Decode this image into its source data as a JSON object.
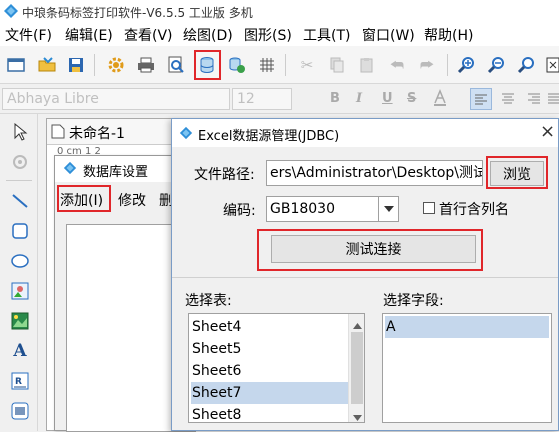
{
  "app": {
    "title": "中琅条码标签打印软件-V6.5.5 工业版 多机"
  },
  "menu": [
    "文件(F)",
    "编辑(E)",
    "查看(V)",
    "绘图(D)",
    "图形(S)",
    "工具(T)",
    "窗口(W)",
    "帮助(H)"
  ],
  "format": {
    "font_name": "Abhaya Libre",
    "font_size": "12",
    "bold": "B",
    "italic": "I",
    "underline": "U",
    "strike": "S"
  },
  "doc": {
    "tab_label": "未命名-1",
    "ruler_text": "0 cm 1 2"
  },
  "db_window": {
    "title": "数据库设置",
    "add_label": "添加(I)",
    "edit_label": "修改",
    "delete_label": "删"
  },
  "dialog": {
    "title": "Excel数据源管理(JDBC)",
    "close": "×",
    "path_label": "文件路径:",
    "path_value": "ers\\Administrator\\Desktop\\测试.xls",
    "browse_label": "浏览",
    "encoding_label": "编码:",
    "encoding_value": "GB18030",
    "first_row_label": "首行含列名",
    "test_label": "测试连接",
    "tables_label": "选择表:",
    "fields_label": "选择字段:",
    "tables": [
      "Sheet4",
      "Sheet5",
      "Sheet6",
      "Sheet7",
      "Sheet8"
    ],
    "selected_table": "Sheet7",
    "fields": [
      "A"
    ]
  },
  "colors": {
    "highlight_red": "#e0262a",
    "selection_blue": "#c5d7ec"
  }
}
